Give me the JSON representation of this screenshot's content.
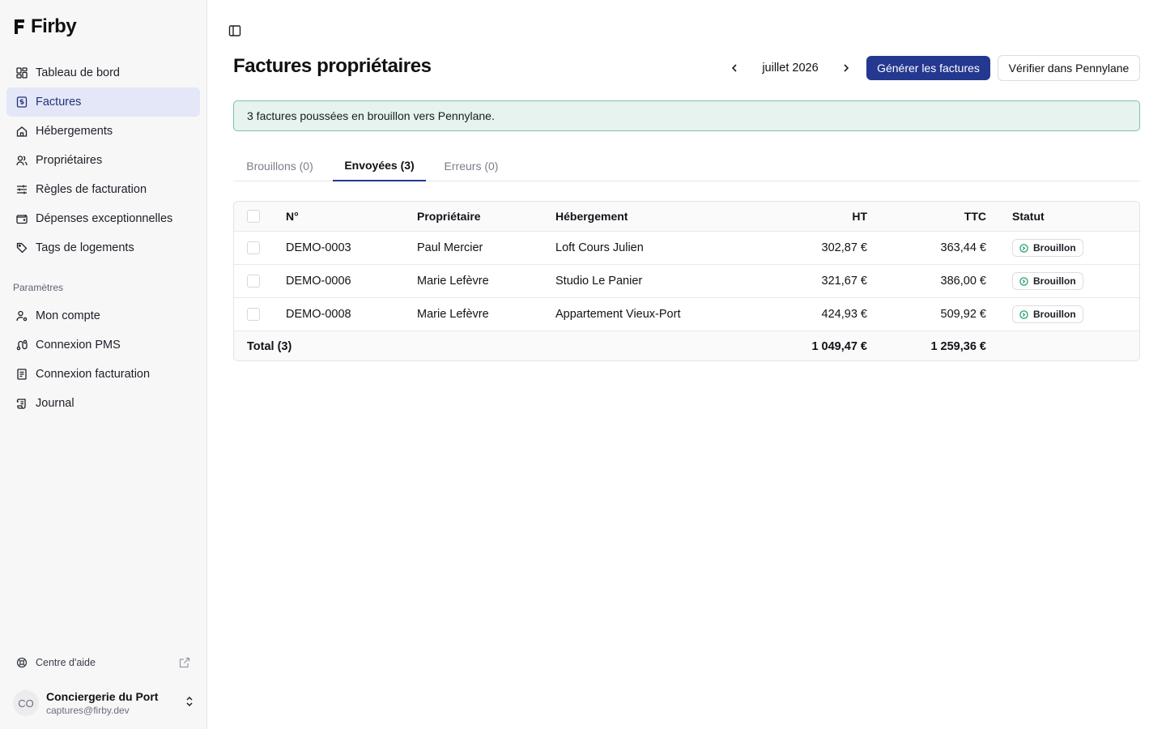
{
  "app": {
    "name": "Firby"
  },
  "sidebar": {
    "items": [
      {
        "label": "Tableau de bord",
        "icon": "dashboard-icon"
      },
      {
        "label": "Factures",
        "icon": "invoice-icon",
        "active": true
      },
      {
        "label": "Hébergements",
        "icon": "home-icon"
      },
      {
        "label": "Propriétaires",
        "icon": "users-icon"
      },
      {
        "label": "Règles de facturation",
        "icon": "sliders-icon"
      },
      {
        "label": "Dépenses exceptionnelles",
        "icon": "wallet-icon"
      },
      {
        "label": "Tags de logements",
        "icon": "tag-icon"
      }
    ],
    "section_label": "Paramètres",
    "settings_items": [
      {
        "label": "Mon compte",
        "icon": "user-cog-icon"
      },
      {
        "label": "Connexion PMS",
        "icon": "route-icon"
      },
      {
        "label": "Connexion facturation",
        "icon": "receipt-icon"
      },
      {
        "label": "Journal",
        "icon": "scroll-icon"
      }
    ],
    "help_label": "Centre d'aide",
    "account": {
      "initials": "CO",
      "name": "Conciergerie du Port",
      "email": "captures@firby.dev"
    }
  },
  "header": {
    "title": "Factures propriétaires",
    "month": "juillet 2026",
    "generate_label": "Générer les factures",
    "verify_label": "Vérifier dans Pennylane"
  },
  "alert": {
    "message": "3 factures poussées en brouillon vers Pennylane."
  },
  "tabs": [
    {
      "label": "Brouillons (0)",
      "active": false
    },
    {
      "label": "Envoyées (3)",
      "active": true
    },
    {
      "label": "Erreurs (0)",
      "active": false
    }
  ],
  "table": {
    "columns": [
      "N°",
      "Propriétaire",
      "Hébergement",
      "HT",
      "TTC",
      "Statut"
    ],
    "rows": [
      {
        "number": "DEMO-0003",
        "owner": "Paul Mercier",
        "property": "Loft Cours Julien",
        "ht": "302,87 €",
        "ttc": "363,44 €",
        "status": "Brouillon"
      },
      {
        "number": "DEMO-0006",
        "owner": "Marie Lefèvre",
        "property": "Studio Le Panier",
        "ht": "321,67 €",
        "ttc": "386,00 €",
        "status": "Brouillon"
      },
      {
        "number": "DEMO-0008",
        "owner": "Marie Lefèvre",
        "property": "Appartement Vieux-Port",
        "ht": "424,93 €",
        "ttc": "509,92 €",
        "status": "Brouillon"
      }
    ],
    "total": {
      "label": "Total (3)",
      "ht": "1 049,47 €",
      "ttc": "1 259,36 €"
    }
  },
  "colors": {
    "accent": "#24388f",
    "active_bg": "#e3e7f8",
    "alert_bg": "#e6f3ee",
    "alert_border": "#7cc4a5",
    "status_green": "#2f9d6e"
  }
}
